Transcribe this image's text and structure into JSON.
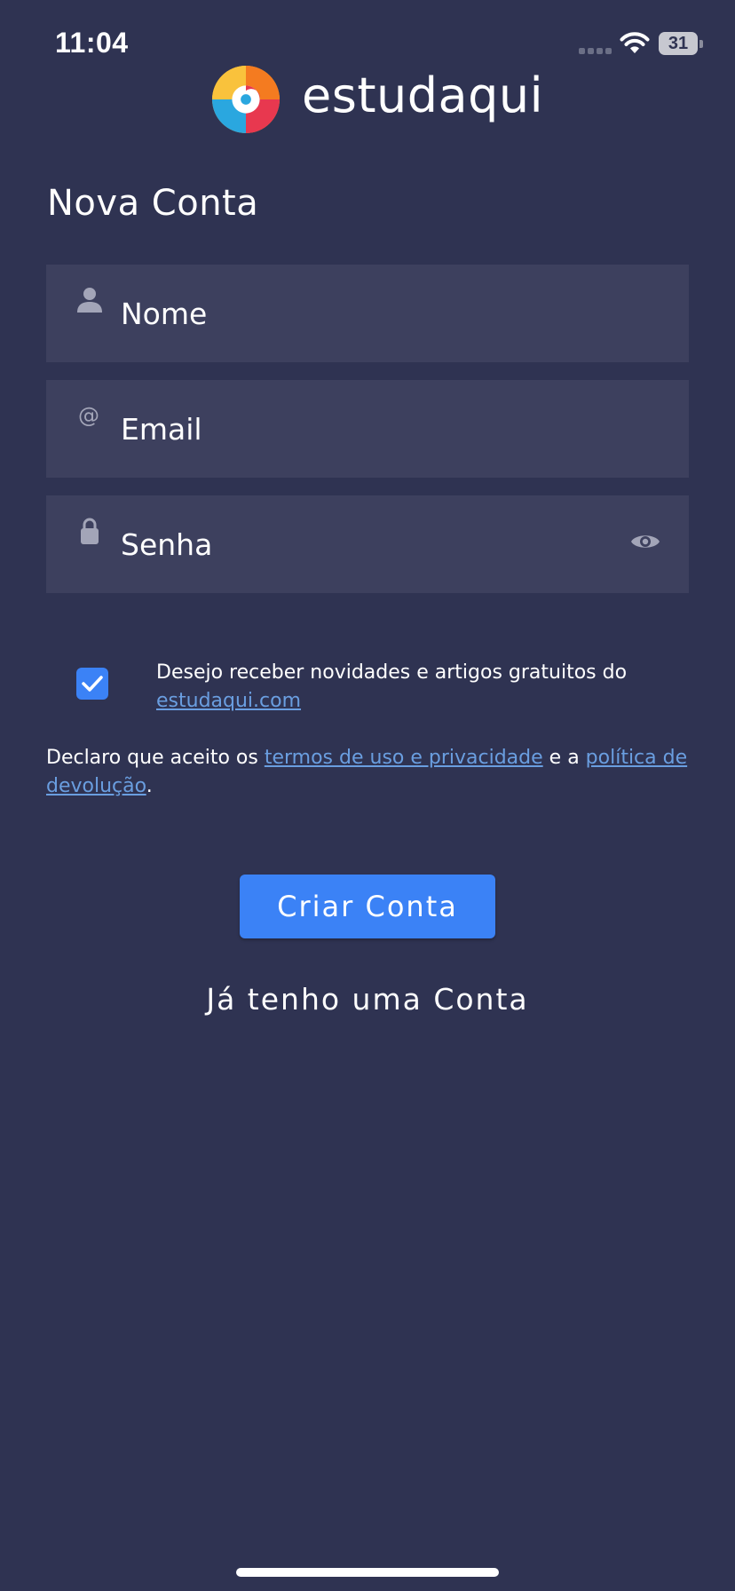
{
  "status_bar": {
    "time": "11:04",
    "battery": "31"
  },
  "brand": {
    "name": "estudaqui",
    "logo_icon": "estudaqui-swirl-logo"
  },
  "page": {
    "title": "Nova Conta"
  },
  "form": {
    "name_placeholder": "Nome",
    "email_placeholder": "Email",
    "password_placeholder": "Senha",
    "icons": {
      "name": "person-icon",
      "email": "at-icon",
      "password": "lock-icon",
      "reveal": "eye-icon"
    }
  },
  "newsletter": {
    "checked": true,
    "text": "Desejo receber novidades e artigos gratuitos do ",
    "link": "estudaqui.com"
  },
  "terms": {
    "prefix": "Declaro que aceito os ",
    "terms_link": "termos de uso e privacidade",
    "middle": " e a ",
    "refund_link": "política de devolução",
    "suffix": "."
  },
  "actions": {
    "create_label": "Criar Conta",
    "login_label": "Já tenho uma Conta"
  },
  "colors": {
    "background": "#2f3352",
    "field": "#3d405e",
    "accent": "#3b82f6",
    "link": "#6a9ee0"
  }
}
